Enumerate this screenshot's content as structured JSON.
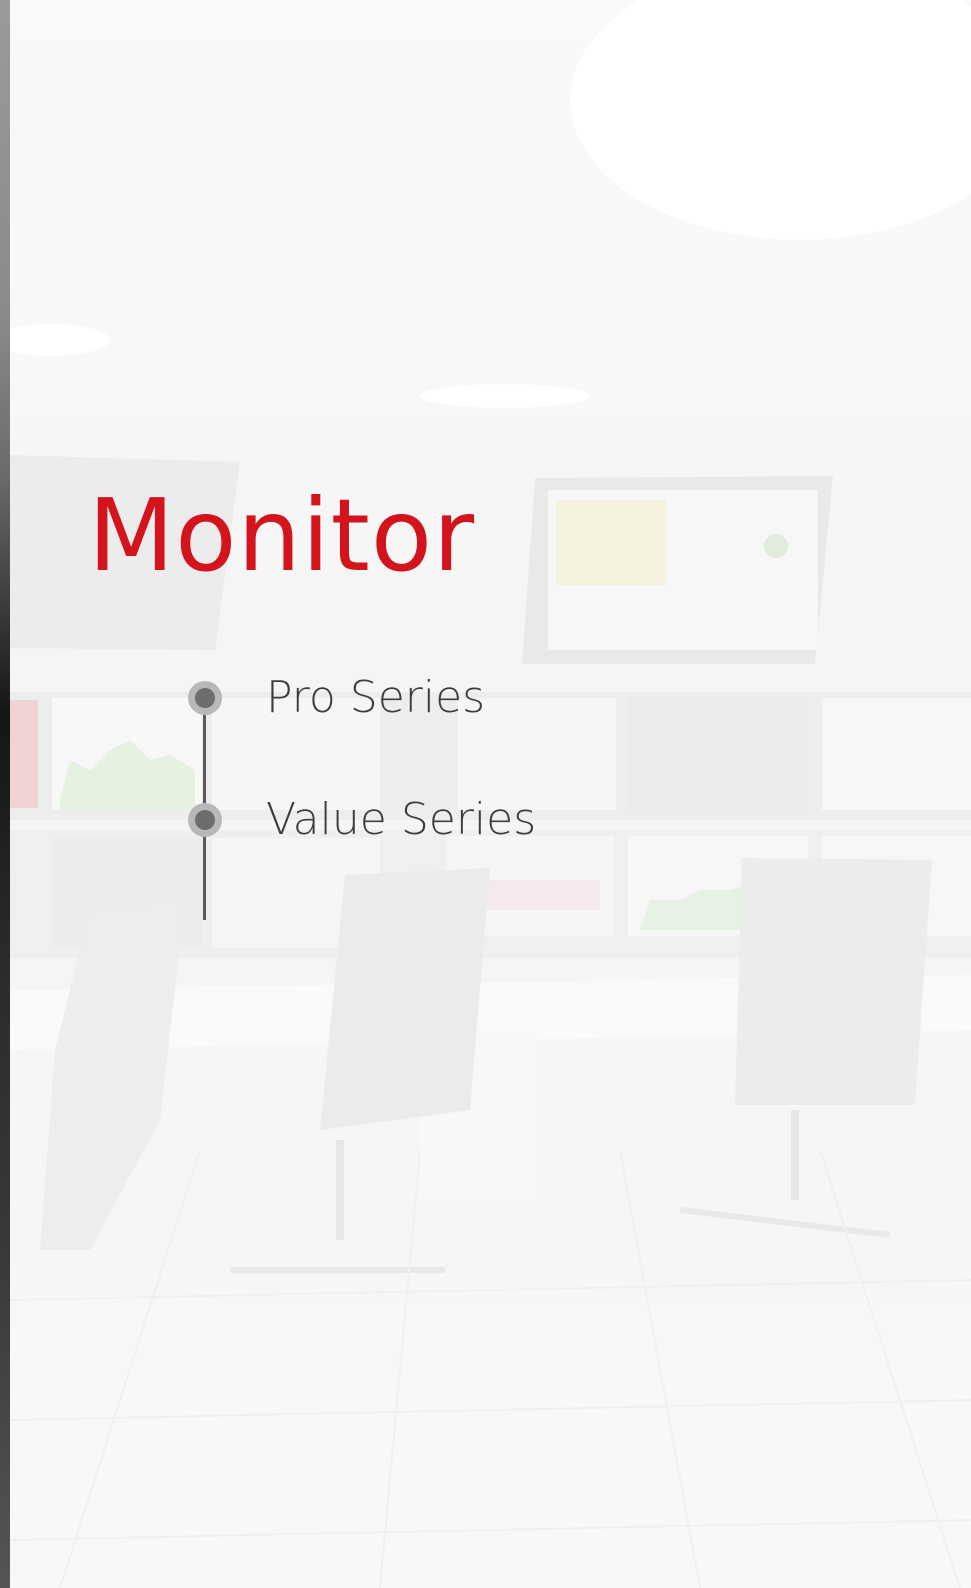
{
  "heading": {
    "title": "Monitor"
  },
  "series": [
    {
      "label": "Pro Series"
    },
    {
      "label": "Value Series"
    }
  ],
  "colors": {
    "accent": "#d3141d",
    "text": "#3c3c3c",
    "dot_outer": "#b8b8b8",
    "dot_inner": "#6d6d6d"
  }
}
